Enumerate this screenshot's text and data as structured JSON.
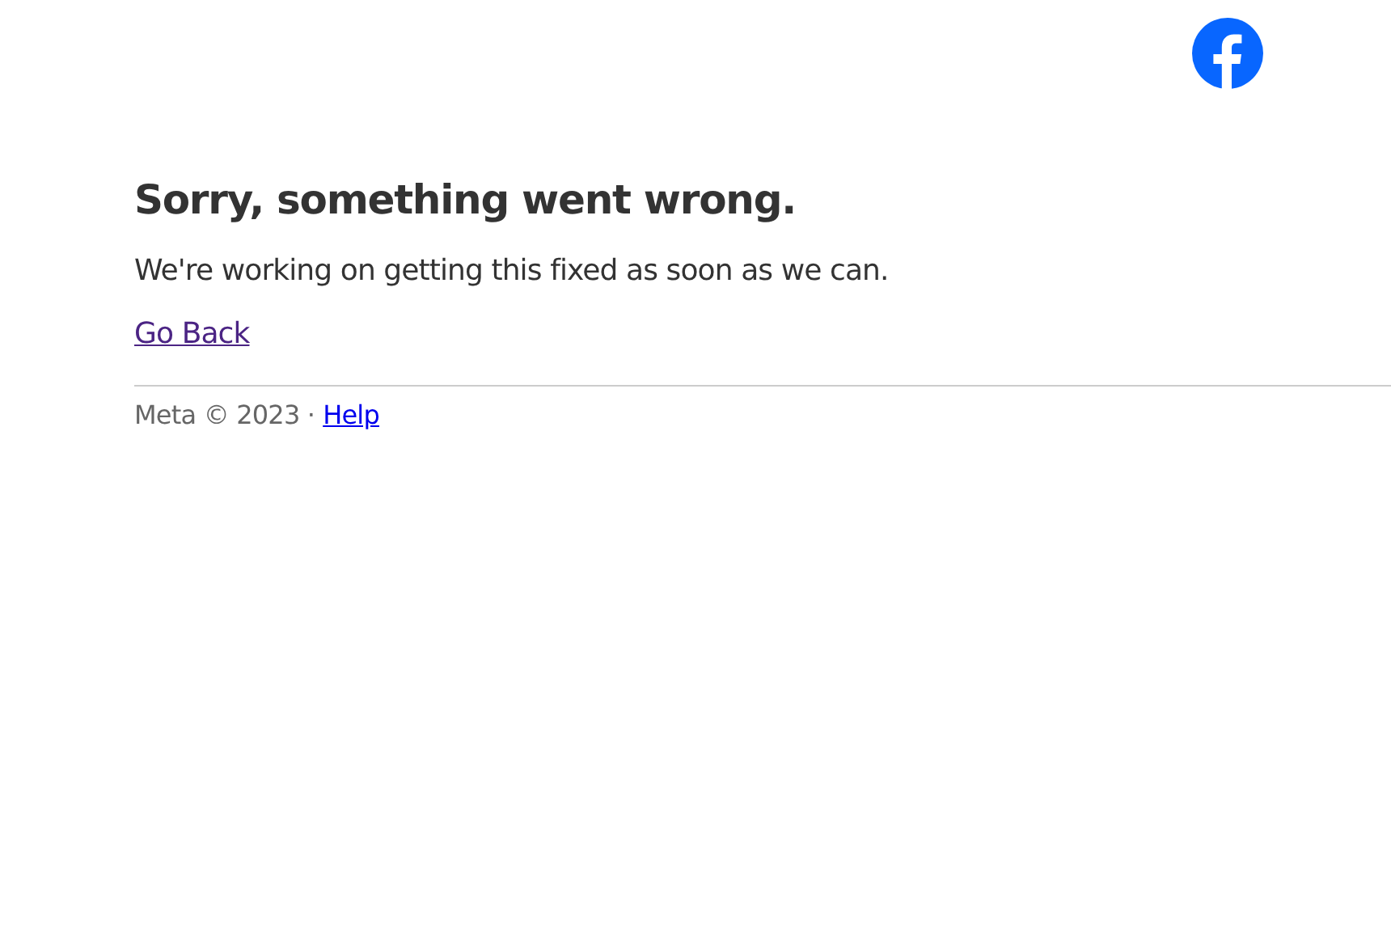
{
  "heading": "Sorry, something went wrong.",
  "message": "We're working on getting this fixed as soon as we can.",
  "back_link": "Go Back",
  "footer": {
    "text": "Meta © 2023 ·",
    "help_link": "Help"
  }
}
